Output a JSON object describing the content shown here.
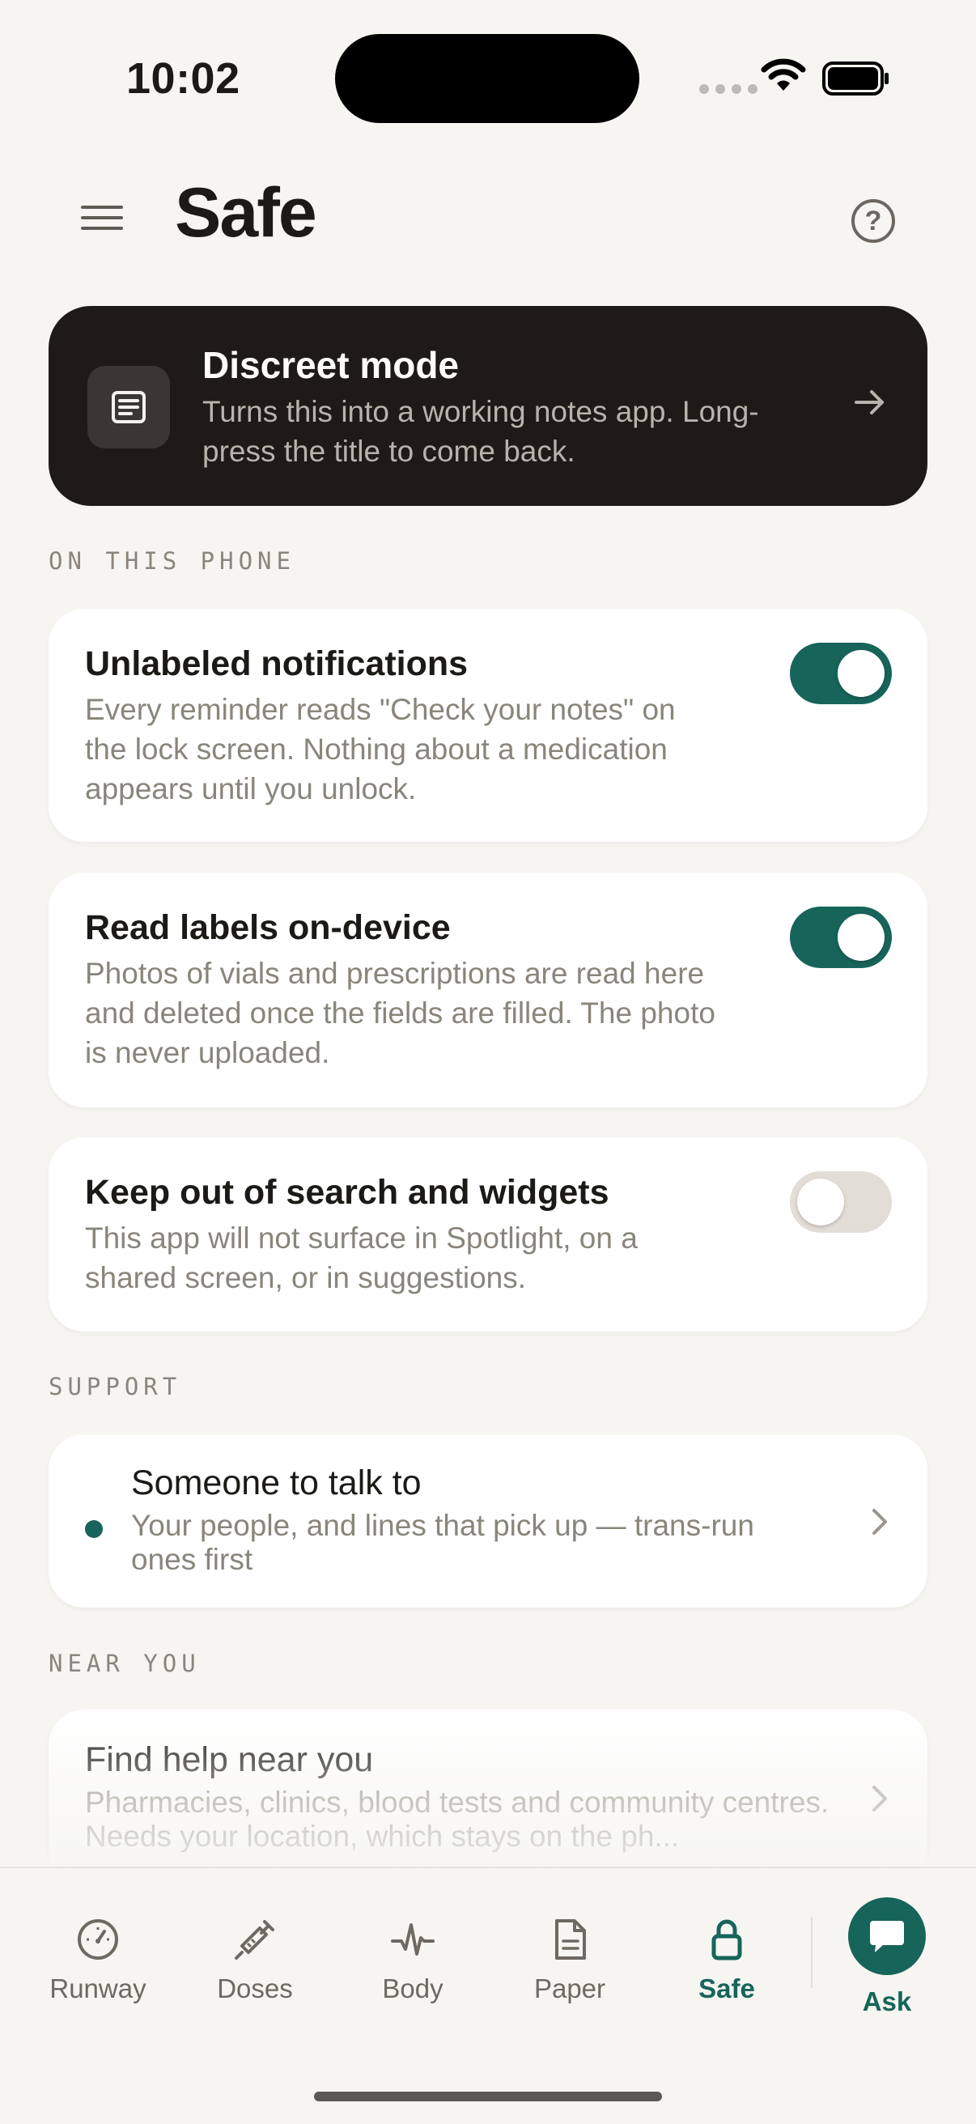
{
  "status_bar": {
    "time": "10:02"
  },
  "header": {
    "title": "Safe",
    "menu_icon": "hamburger-icon",
    "help_icon": "question-circle-icon",
    "help_glyph": "?"
  },
  "discreet": {
    "title": "Discreet mode",
    "subtitle": "Turns this into a working notes app. Long-press the title to come back.",
    "icon": "notes-icon"
  },
  "sections": {
    "on_this_phone": "ON THIS PHONE",
    "support": "SUPPORT",
    "near_you": "NEAR YOU"
  },
  "settings": [
    {
      "title": "Unlabeled notifications",
      "description": "Every reminder reads \"Check your notes\" on the lock screen. Nothing about a medication appears until you unlock.",
      "enabled": true
    },
    {
      "title": "Read labels on-device",
      "description": "Photos of vials and prescriptions are read here and deleted once the fields are filled. The photo is never uploaded.",
      "enabled": true
    },
    {
      "title": "Keep out of search and widgets",
      "description": "This app will not surface in Spotlight, on a shared screen, or in suggestions.",
      "enabled": false
    }
  ],
  "support": {
    "title": "Someone to talk to",
    "description": "Your people, and lines that pick up — trans-run ones first"
  },
  "near_you": {
    "title": "Find help near you",
    "description": "Pharmacies, clinics, blood tests and community centres. Needs your location, which stays on the ph..."
  },
  "nav": {
    "items": [
      {
        "label": "Runway",
        "icon": "gauge-icon"
      },
      {
        "label": "Doses",
        "icon": "syringe-icon"
      },
      {
        "label": "Body",
        "icon": "pulse-icon"
      },
      {
        "label": "Paper",
        "icon": "document-icon"
      },
      {
        "label": "Safe",
        "icon": "lock-icon",
        "active": true
      }
    ],
    "ask_label": "Ask",
    "ask_icon": "chat-bubble-icon"
  },
  "colors": {
    "accent": "#17645a",
    "background": "#f6f5f1",
    "dark_card": "#1d1a17"
  }
}
